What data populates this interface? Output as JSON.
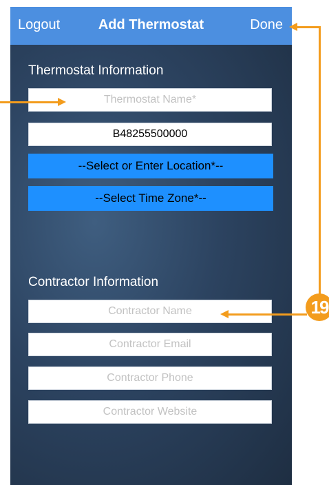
{
  "navbar": {
    "left_label": "Logout",
    "title": "Add Thermostat",
    "right_label": "Done"
  },
  "thermostat_section": {
    "title": "Thermostat Information",
    "name_placeholder": "Thermostat Name*",
    "serial_value": "B48255500000",
    "location_label": "--Select or Enter Location*--",
    "timezone_label": "--Select Time Zone*--"
  },
  "contractor_section": {
    "title": "Contractor Information",
    "name_placeholder": "Contractor Name",
    "email_placeholder": "Contractor Email",
    "phone_placeholder": "Contractor Phone",
    "website_placeholder": "Contractor Website"
  },
  "annotation": {
    "badge_number": "19",
    "color": "#f39c1d"
  },
  "colors": {
    "navbar": "#4c8fe0",
    "select_button": "#1e90ff",
    "background": "#2c4360"
  }
}
